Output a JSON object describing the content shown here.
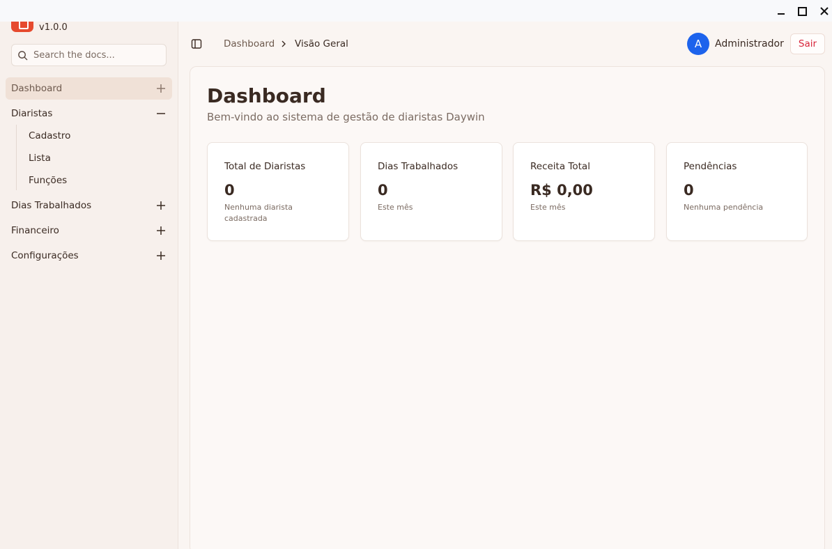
{
  "window": {
    "controls": [
      "minimize-icon",
      "maximize-icon",
      "close-icon"
    ]
  },
  "sidebar": {
    "version": "v1.0.0",
    "search_placeholder": "Search the docs...",
    "items": [
      {
        "label": "Dashboard",
        "toggle": "plus-icon",
        "active": true
      },
      {
        "label": "Diaristas",
        "toggle": "minus-icon",
        "expanded": true,
        "children": [
          "Cadastro",
          "Lista",
          "Funções"
        ]
      },
      {
        "label": "Dias Trabalhados",
        "toggle": "plus-icon"
      },
      {
        "label": "Financeiro",
        "toggle": "plus-icon"
      },
      {
        "label": "Configurações",
        "toggle": "plus-icon"
      }
    ]
  },
  "header": {
    "breadcrumb": [
      "Dashboard",
      "Visão Geral"
    ],
    "user_initial": "A",
    "user_name": "Administrador",
    "logout_label": "Sair"
  },
  "page": {
    "title": "Dashboard",
    "subtitle": "Bem-vindo ao sistema de gestão de diaristas Daywin"
  },
  "cards": [
    {
      "title": "Total de Diaristas",
      "value": "0",
      "description": "Nenhuma diarista cadastrada"
    },
    {
      "title": "Dias Trabalhados",
      "value": "0",
      "description": "Este mês"
    },
    {
      "title": "Receita Total",
      "value": "R$ 0,00",
      "description": "Este mês"
    },
    {
      "title": "Pendências",
      "value": "0",
      "description": "Nenhuma pendência"
    }
  ],
  "colors": {
    "accent": "#e64a2e",
    "avatar": "#1d63ec",
    "logout_text": "#d8253a",
    "active_nav": "#f0e1d7"
  }
}
